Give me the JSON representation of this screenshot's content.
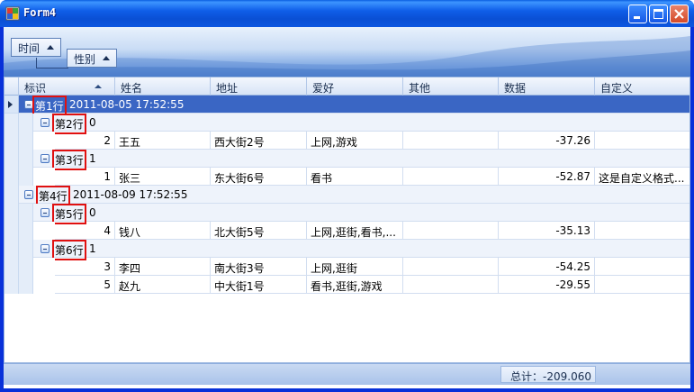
{
  "window": {
    "title": "Form4"
  },
  "group_panel": {
    "chips": [
      {
        "label": "时间"
      },
      {
        "label": "性别"
      }
    ]
  },
  "grid": {
    "columns": [
      "标识",
      "姓名",
      "地址",
      "爱好",
      "其他",
      "数据",
      "自定义"
    ],
    "groups": [
      {
        "label": "第1行",
        "value": "2011-08-05 17:52:55",
        "subgroups": [
          {
            "label": "第2行",
            "value": "0",
            "rows": [
              {
                "id": "2",
                "name": "王五",
                "address": "西大街2号",
                "hobby": "上网,游戏",
                "other": "",
                "data": "-37.26",
                "custom": ""
              }
            ]
          },
          {
            "label": "第3行",
            "value": "1",
            "rows": [
              {
                "id": "1",
                "name": "张三",
                "address": "东大街6号",
                "hobby": "看书",
                "other": "",
                "data": "-52.87",
                "custom": "这是自定义格式..."
              }
            ]
          }
        ]
      },
      {
        "label": "第4行",
        "value": "2011-08-09 17:52:55",
        "subgroups": [
          {
            "label": "第5行",
            "value": "0",
            "rows": [
              {
                "id": "4",
                "name": "钱八",
                "address": "北大街5号",
                "hobby": "上网,逛街,看书,...",
                "other": "",
                "data": "-35.13",
                "custom": ""
              }
            ]
          },
          {
            "label": "第6行",
            "value": "1",
            "rows": [
              {
                "id": "3",
                "name": "李四",
                "address": "南大街3号",
                "hobby": "上网,逛街",
                "other": "",
                "data": "-54.25",
                "custom": ""
              },
              {
                "id": "5",
                "name": "赵九",
                "address": "中大街1号",
                "hobby": "看书,逛街,游戏",
                "other": "",
                "data": "-29.55",
                "custom": ""
              }
            ]
          }
        ]
      }
    ]
  },
  "footer": {
    "summary": "总计：-209.060"
  }
}
